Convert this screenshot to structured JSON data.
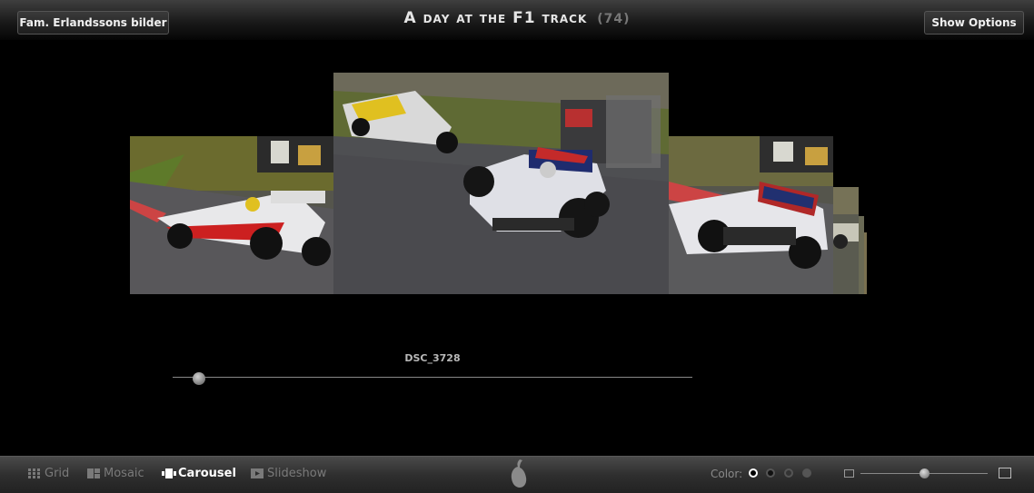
{
  "header": {
    "album_button": "Fam. Erlandssons bilder",
    "title": "A day at the F1 track",
    "count": "(74)",
    "options_button": "Show Options"
  },
  "carousel": {
    "current_photo": "DSC_3728",
    "position": 0.05
  },
  "toolbar": {
    "modes": [
      {
        "label": "Grid",
        "icon": "grid-icon",
        "active": false
      },
      {
        "label": "Mosaic",
        "icon": "mosaic-icon",
        "active": false
      },
      {
        "label": "Carousel",
        "icon": "carousel-icon",
        "active": true
      },
      {
        "label": "Slideshow",
        "icon": "slideshow-icon",
        "active": false
      }
    ],
    "color_label": "Color:",
    "colors": [
      "#000000",
      "#111111",
      "#333333",
      "#555555"
    ],
    "selected_color": 0,
    "zoom": 0.5
  }
}
